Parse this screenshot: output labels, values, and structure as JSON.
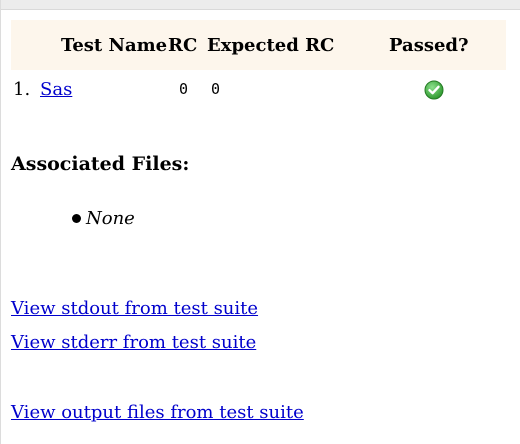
{
  "table": {
    "headers": {
      "test_name": "Test Name",
      "rc": "RC",
      "expected_rc": "Expected RC",
      "passed": "Passed?"
    },
    "rows": [
      {
        "index": "1.",
        "name": "Sas",
        "rc": "0",
        "expected_rc": "0",
        "passed_icon": "check-circle-icon",
        "passed_color": "#3aa83a"
      }
    ]
  },
  "associated_files": {
    "heading": "Associated Files:",
    "items": [
      "None"
    ]
  },
  "links": {
    "stdout": "View stdout from test suite",
    "stderr": "View stderr from test suite",
    "output_files": "View output files from test suite"
  },
  "colors": {
    "header_background": "#fdf6ec",
    "link": "#0000cc",
    "pass": "#3aa83a"
  }
}
